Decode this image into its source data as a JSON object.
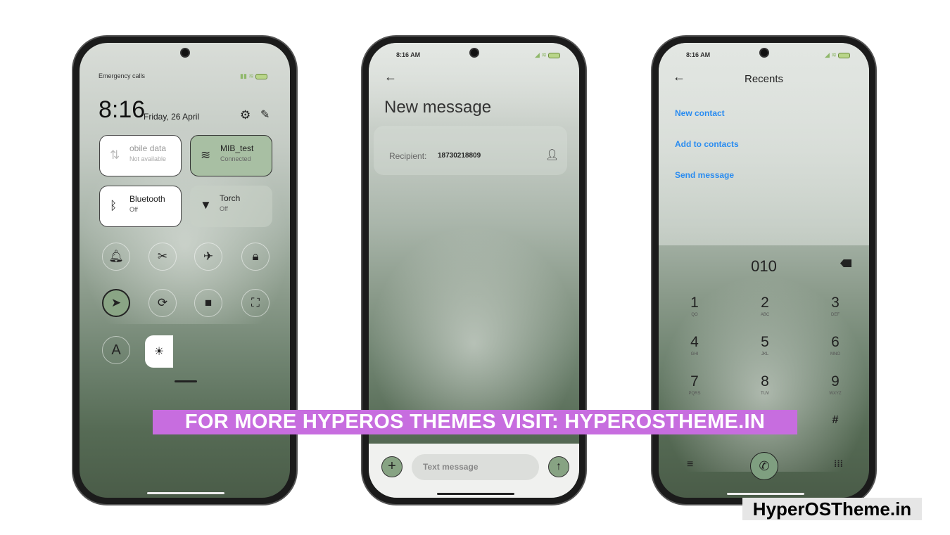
{
  "phone1": {
    "status_left": "Emergency calls",
    "time": "8:16",
    "date": "Friday, 26 April",
    "tiles": [
      {
        "title": "obile data",
        "sub": "Not available"
      },
      {
        "title": "MIB_test",
        "sub": "Connected"
      },
      {
        "title": "Bluetooth",
        "sub": "Off"
      },
      {
        "title": "Torch",
        "sub": "Off"
      }
    ],
    "toggles": [
      "bell-icon",
      "screenshot-icon",
      "airplane-icon",
      "lock-icon",
      "location-icon",
      "rotation-lock-icon",
      "video-icon",
      "scan-icon"
    ],
    "font_toggle": "A"
  },
  "phone2": {
    "status_time": "8:16 AM",
    "title": "New message",
    "recipient_label": "Recipient:",
    "recipient_value": "18730218809",
    "input_placeholder": "Text message"
  },
  "phone3": {
    "status_time": "8:16 AM",
    "title": "Recents",
    "links": [
      "New contact",
      "Add to contacts",
      "Send message"
    ],
    "dialed": "010",
    "keys": [
      {
        "d": "1",
        "l": "QO"
      },
      {
        "d": "2",
        "l": "ABC"
      },
      {
        "d": "3",
        "l": "DEF"
      },
      {
        "d": "4",
        "l": "GHI"
      },
      {
        "d": "5",
        "l": "JKL"
      },
      {
        "d": "6",
        "l": "MNO"
      },
      {
        "d": "7",
        "l": "PQRS"
      },
      {
        "d": "8",
        "l": "TUV"
      },
      {
        "d": "9",
        "l": "WXYZ"
      }
    ],
    "hash": "#"
  },
  "banner": "FOR MORE HYPEROS THEMES VISIT: HYPEROSTHEME.IN",
  "watermark": "HyperOSTheme.in",
  "colors": {
    "accent_green": "#87a383",
    "link_blue": "#2a8cf0",
    "banner": "#c76ddf"
  }
}
